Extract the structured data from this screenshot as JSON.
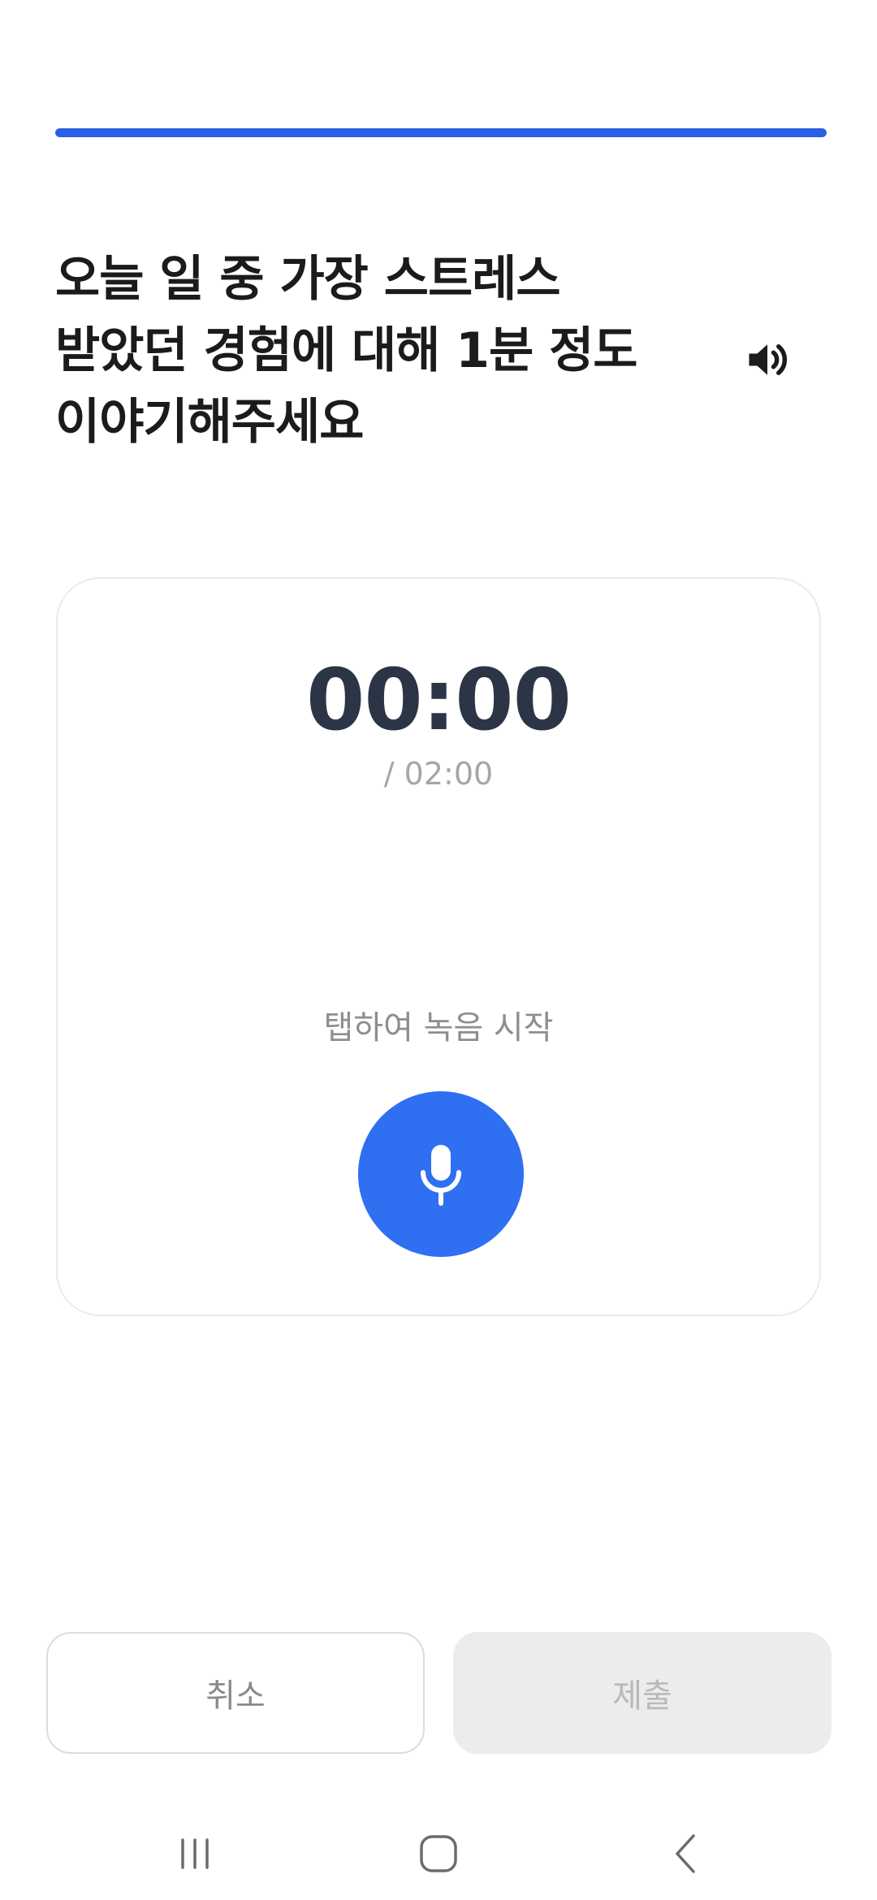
{
  "progress": {
    "value_percent": 100,
    "color": "#2a5fe6"
  },
  "question": {
    "lines": [
      "오늘 일 중 가장 스트레스",
      "받았던 경험에 대해 1분 정도",
      "이야기해주세요"
    ],
    "speaker_icon": "speaker-volume-icon"
  },
  "recorder": {
    "elapsed": "00:00",
    "limit": "/ 02:00",
    "hint": "탭하여 녹음 시작",
    "mic_icon": "microphone-icon",
    "mic_color": "#2f6ff2"
  },
  "actions": {
    "cancel_label": "취소",
    "submit_label": "제출"
  },
  "system_nav": {
    "icons": [
      "recent-apps-icon",
      "home-icon",
      "back-icon"
    ]
  }
}
